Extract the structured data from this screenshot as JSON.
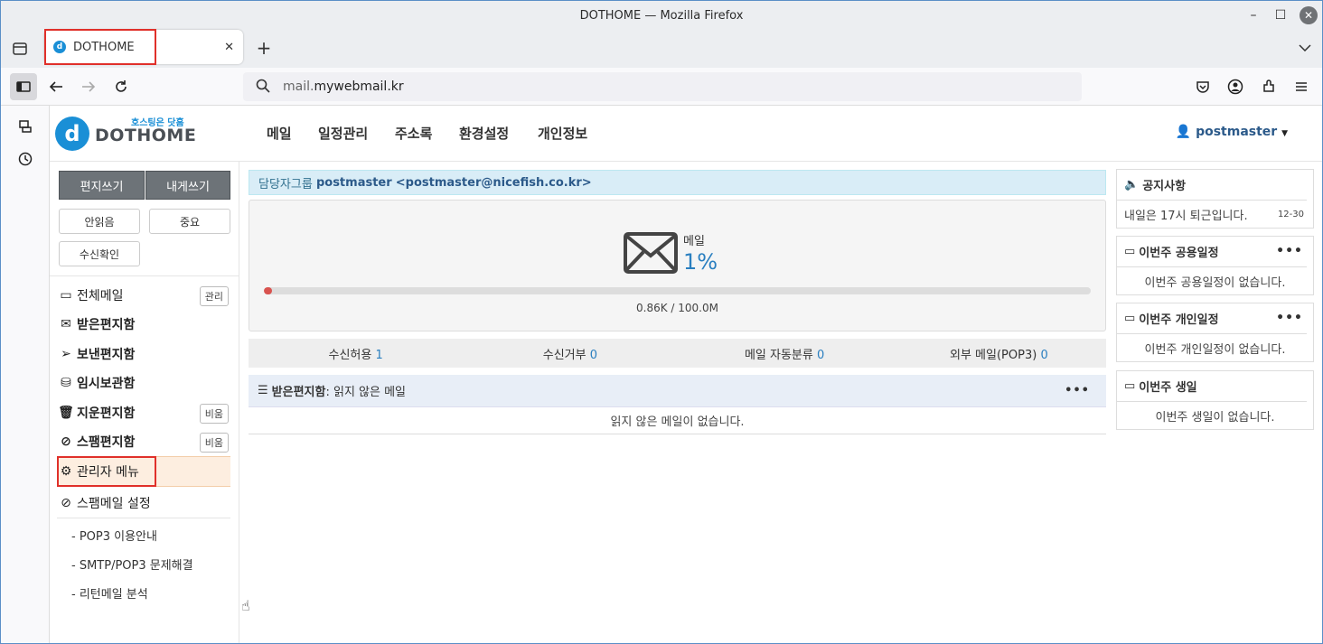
{
  "window": {
    "title": "DOTHOME — Mozilla Firefox"
  },
  "browser": {
    "tab_title": "DOTHOME",
    "url_prefix": "mail.",
    "url_domain": "mywebmail.kr"
  },
  "site": {
    "logo_tagline": "호스팅은 닷홈",
    "logo_name": "DOTHOME",
    "nav": [
      {
        "label": "메일"
      },
      {
        "label": "일정관리"
      },
      {
        "label": "주소록"
      },
      {
        "label": "환경설정"
      },
      {
        "label": "개인정보"
      }
    ],
    "user": "postmaster"
  },
  "left": {
    "compose": "편지쓰기",
    "self_compose": "내게쓰기",
    "unread": "안읽음",
    "important": "중요",
    "receipt": "수신확인",
    "menu": [
      {
        "label": "전체메일",
        "tag": "관리"
      },
      {
        "label": "받은편지함",
        "tag": ""
      },
      {
        "label": "보낸편지함",
        "tag": ""
      },
      {
        "label": "임시보관함",
        "tag": ""
      },
      {
        "label": "지운편지함",
        "tag": "비움"
      },
      {
        "label": "스팸편지함",
        "tag": "비움"
      }
    ],
    "admin_menu": "관리자 메뉴",
    "spam_settings": "스팸메일 설정",
    "links": [
      "- POP3 이용안내",
      "- SMTP/POP3 문제해결",
      "- 리턴메일 분석"
    ]
  },
  "main": {
    "group_label": "담당자그룹",
    "account_name": "postmaster",
    "account_email": "<postmaster@nicefish.co.kr>",
    "quota_label": "메일",
    "quota_percent": "1%",
    "quota_fraction": 0.01,
    "quota_usage": "0.86K / 100.0M",
    "stats": [
      {
        "label": "수신허용",
        "value": "1"
      },
      {
        "label": "수신거부",
        "value": "0"
      },
      {
        "label": "메일 자동분류",
        "value": "0"
      },
      {
        "label": "외부 메일(POP3)",
        "value": "0"
      }
    ],
    "inbox_title": "받은편지함",
    "inbox_sub": " : 읽지 않은 메일",
    "inbox_empty": "읽지 않은 메일이 없습니다."
  },
  "right": {
    "notice_title": "공지사항",
    "notice_text": "내일은 17시 퇴근입니다.",
    "notice_date": "12-30",
    "shared_title": "이번주 공용일정",
    "shared_empty": "이번주 공용일정이 없습니다.",
    "personal_title": "이번주 개인일정",
    "personal_empty": "이번주 개인일정이 없습니다.",
    "birthday_title": "이번주 생일",
    "birthday_empty": "이번주 생일이 없습니다."
  },
  "colors": {
    "highlight": "#e0302a",
    "link": "#2c5a8a",
    "logo": "#1a8fd6"
  }
}
